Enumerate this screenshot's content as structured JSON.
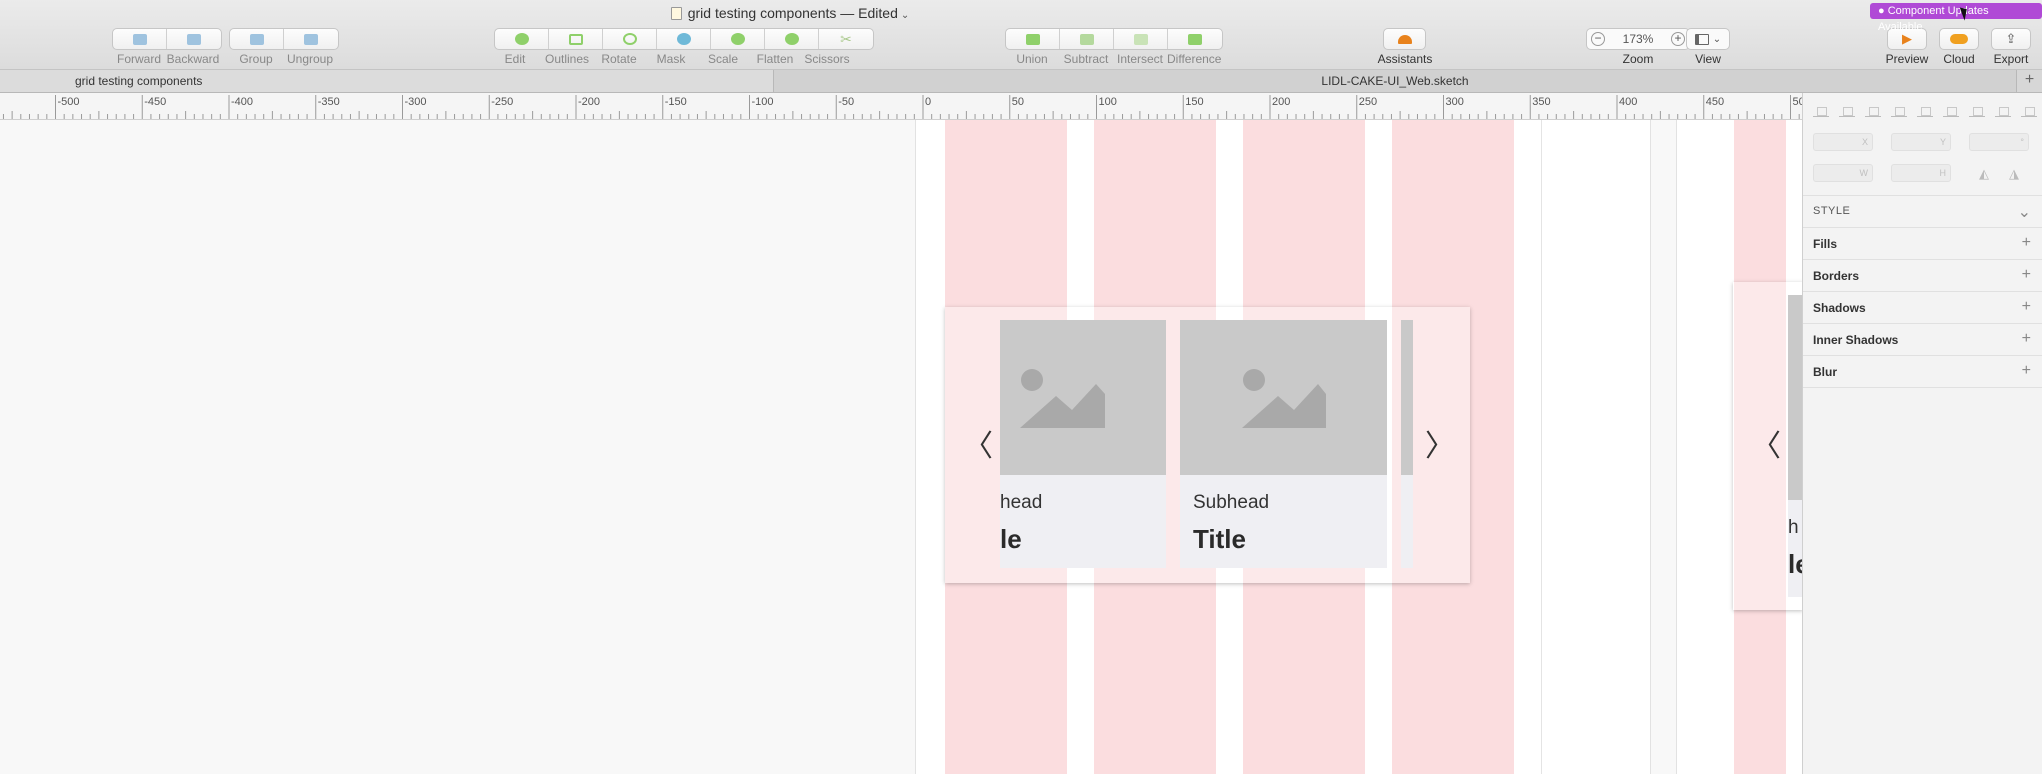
{
  "window": {
    "title": "grid testing components — Edited",
    "caret": "⌄",
    "badge": "● Component Updates Available"
  },
  "toolbar": {
    "groups": [
      {
        "items": [
          {
            "label": "Forward",
            "color": "#9fc3df"
          },
          {
            "label": "Backward",
            "color": "#9fc3df"
          }
        ]
      },
      {
        "items": [
          {
            "label": "Group",
            "color": "#9fc3df"
          },
          {
            "label": "Ungroup",
            "color": "#9fc3df"
          }
        ]
      },
      {
        "items": [
          {
            "label": "Edit",
            "color": "#8fd06a"
          },
          {
            "label": "Outlines",
            "color": "#8fd06a"
          },
          {
            "label": "Rotate",
            "color": "#8fd06a"
          },
          {
            "label": "Mask",
            "color": "#6fb9d8"
          },
          {
            "label": "Scale",
            "color": "#8fd06a"
          },
          {
            "label": "Flatten",
            "color": "#8fd06a"
          },
          {
            "label": "Scissors",
            "color": "#aac98d"
          }
        ]
      },
      {
        "items": [
          {
            "label": "Union",
            "color": "#8fd06a"
          },
          {
            "label": "Subtract",
            "color": "#b4d99d"
          },
          {
            "label": "Intersect",
            "color": "#c9e3b7"
          },
          {
            "label": "Difference",
            "color": "#8fd06a"
          }
        ]
      }
    ],
    "assistants": "Assistants",
    "zoom": {
      "label": "Zoom",
      "value": "173%",
      "minus": "−",
      "plus": "+"
    },
    "view": "View",
    "preview": "Preview",
    "cloud": "Cloud",
    "export": "Export"
  },
  "tabs": {
    "left": "grid testing components",
    "right": "LIDL-CAKE-UI_Web.sketch",
    "plus": "+"
  },
  "ruler": {
    "labels": [
      "-500",
      "-450",
      "-400",
      "-350",
      "-300",
      "-250",
      "-200",
      "-150",
      "-100",
      "-50",
      "0",
      "50",
      "100",
      "150",
      "200",
      "250",
      "300",
      "350",
      "400",
      "450",
      "50"
    ]
  },
  "canvas": {
    "cards": [
      {
        "subhead": "head",
        "title": "le"
      },
      {
        "subhead": "Subhead",
        "title": "Title"
      }
    ],
    "prev_arrow": "〈",
    "next_arrow": "〉",
    "partial": {
      "subhead": "h",
      "title": "le"
    }
  },
  "inspector": {
    "fields": {
      "x": "X",
      "y": "Y",
      "w": "W",
      "h": "H",
      "extra": "°"
    },
    "style_header": "STYLE",
    "sections": [
      "Fills",
      "Borders",
      "Shadows",
      "Inner Shadows",
      "Blur"
    ],
    "plus": "+",
    "chevron": "⌄"
  }
}
